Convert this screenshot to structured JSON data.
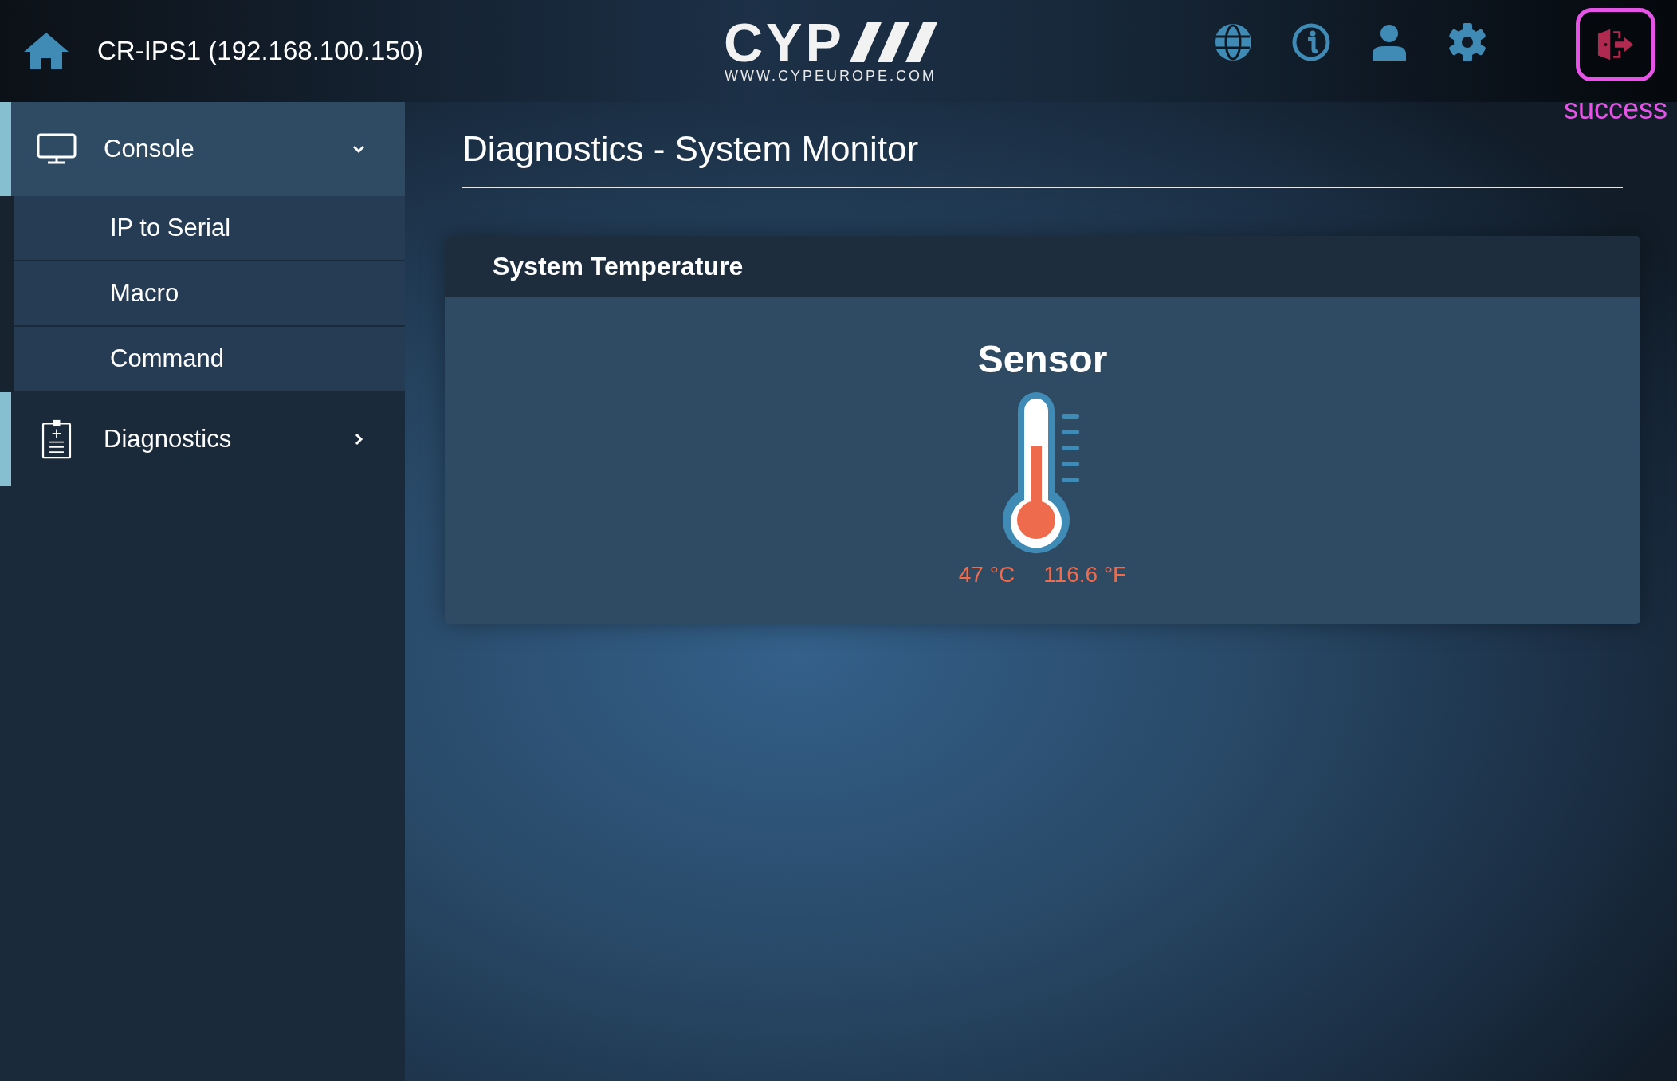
{
  "header": {
    "device": "CR-IPS1 (192.168.100.150)",
    "logo": {
      "mark": "CYP",
      "url": "WWW.CYPEUROPE.COM"
    },
    "logout_status": "success"
  },
  "sidebar": {
    "items": [
      {
        "label": "Console",
        "expanded": true,
        "children": [
          {
            "label": "IP to Serial"
          },
          {
            "label": "Macro"
          },
          {
            "label": "Command"
          }
        ]
      },
      {
        "label": "Diagnostics",
        "expanded": false
      }
    ]
  },
  "page": {
    "title": "Diagnostics - System Monitor",
    "panel": {
      "title": "System Temperature",
      "sensor": {
        "name": "Sensor",
        "level": 0.6,
        "celsius": "47 °C",
        "fahrenheit": "116.6 °F"
      }
    }
  }
}
